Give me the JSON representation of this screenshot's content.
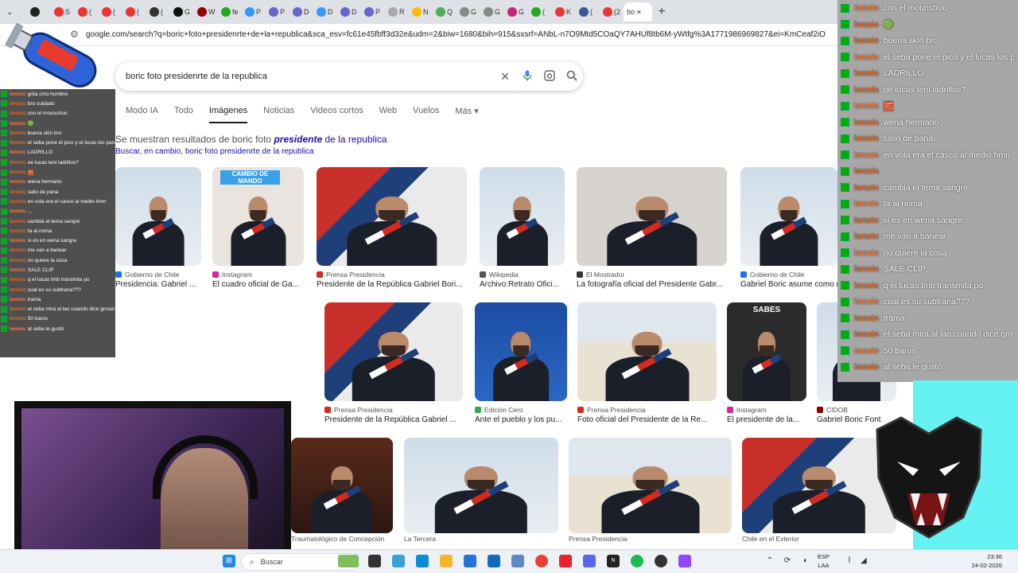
{
  "browser": {
    "tab_labels": [
      "",
      "S",
      "(",
      "(",
      "(",
      "(",
      "G",
      "W",
      "fe",
      "P",
      "P",
      "D",
      "D",
      "D",
      "P",
      "R",
      "N",
      "Q",
      "G",
      "G",
      "G",
      "(",
      "K",
      "(",
      "(2"
    ],
    "active_tab_label": "bo",
    "new_tab": "+",
    "url": "google.com/search?q=boric+foto+presidenrte+de+la+republica&sca_esv=fc61e45fbff3d32e&udm=2&biw=1680&bih=915&sxsrf=ANbL-n7O9Mtd5COaQY7AHUf8tb6M-yWtfg%3A1771986969827&ei=KmCeaf2iON34..."
  },
  "search": {
    "query": "boric foto presidenrte de la republica",
    "clear_icon": "✕",
    "tabs": [
      "Modo IA",
      "Todo",
      "Imágenes",
      "Noticias",
      "Videos cortos",
      "Web",
      "Vuelos",
      "Más ▾"
    ],
    "selected_tab": "Imágenes",
    "showing_prefix": "Se muestran resultados de boric foto",
    "showing_bold": "presidente",
    "showing_suffix": "de la republica",
    "search_instead": "Buscar, en cambio, boric foto presidenrte de la republica"
  },
  "results_row1": [
    {
      "source": "Gobierno de Chile",
      "title": "Presidencia: Gabriel ...",
      "color": "#1a73e8"
    },
    {
      "source": "Instagram",
      "title": "El cuadro oficial de Ga...",
      "color": "#d6249f",
      "badge": "CAMBIO DE MANDO"
    },
    {
      "source": "Prensa Presidencia",
      "title": "Presidente de la República Gabriel Bori...",
      "color": "#d52b1e"
    },
    {
      "source": "Wikipedia",
      "title": "Archivo:Retrato Ofici...",
      "color": "#555555"
    },
    {
      "source": "El Mostrador",
      "title": "La fotografía oficial del Presidente Gabr...",
      "color": "#333333"
    },
    {
      "source": "Gobierno de Chile",
      "title": "Gabriel Boric asume como nuevo Presid...",
      "color": "#1a73e8"
    }
  ],
  "results_row2": [
    {
      "source": "Prensa Presidencia",
      "title": "Presidente de la República Gabriel ...",
      "color": "#d52b1e"
    },
    {
      "source": "Edición Cero",
      "title": "Ante el pueblo y los pu...",
      "color": "#34a853"
    },
    {
      "source": "Prensa Presidencia",
      "title": "Foto oficial del Presidente de la Re...",
      "color": "#d52b1e"
    },
    {
      "source": "Instagram",
      "title": "El presidente de la...",
      "color": "#d6249f",
      "badge": "SABES"
    },
    {
      "source": "CIDOB",
      "title": "Gabriel Boric Font",
      "color": "#8b0000"
    }
  ],
  "results_row3": [
    {
      "source": "Traumatológico de Concepción",
      "title": ""
    },
    {
      "source": "La Tercera",
      "title": ""
    },
    {
      "source": "Prensa Presidencia",
      "title": ""
    },
    {
      "source": "Chile en el Exterior",
      "title": ""
    }
  ],
  "chat_right": [
    {
      "user": "lonxin",
      "text": ": con el mounstruo"
    },
    {
      "user": "lonxin",
      "text": ": 🟢"
    },
    {
      "user": "lonxin",
      "text": ": buena skin bro"
    },
    {
      "user": "lonxin",
      "text": ": el seba pone el pico y el lucas los p"
    },
    {
      "user": "lonxin",
      "text": ": LADRILLO"
    },
    {
      "user": "lonxin",
      "text": ": oe lucas teni ladrillos?"
    },
    {
      "user": "lonxin",
      "text": ": 🧱"
    },
    {
      "user": "lonxin",
      "text": ": wena hermano"
    },
    {
      "user": "lonxin",
      "text": ": salio de pana"
    },
    {
      "user": "lonxin",
      "text": ": en vola era el casco al medio hmn"
    },
    {
      "user": "lonxin",
      "text": ": ..."
    },
    {
      "user": "lonxin",
      "text": ": cambia el tema sangre"
    },
    {
      "user": "lonxin",
      "text": ": ta ai noma"
    },
    {
      "user": "lonxin",
      "text": ": si es en wena sangre"
    },
    {
      "user": "lonxin",
      "text": ": me van a banear"
    },
    {
      "user": "lonxin",
      "text": ": no quiere la cosa"
    },
    {
      "user": "lonxin",
      "text": ": SALE CLIP"
    },
    {
      "user": "lonxin",
      "text": ": q el lucas tmb transmita po"
    },
    {
      "user": "lonxin",
      "text": ": cual es su subtrana???"
    },
    {
      "user": "lonxin",
      "text": ": trama"
    },
    {
      "user": "lonxin",
      "text": ": el seba mira al lao cuando dice gro"
    },
    {
      "user": "lonxin",
      "text": ": 50 baros"
    },
    {
      "user": "lonxin",
      "text": ": al seba le gustó"
    }
  ],
  "chat_left": [
    {
      "user": "lonxin",
      "text": ": grita cmo hombre"
    },
    {
      "user": "lonxin",
      "text": ": bro cuidado"
    },
    {
      "user": "lonxin",
      "text": ": con el mounstruo"
    },
    {
      "user": "lonxin",
      "text": ": 🟢"
    },
    {
      "user": "lonxin",
      "text": ": buena skin bro"
    },
    {
      "user": "lonxin",
      "text": ": el seba pone el pico y el lucas los pana"
    },
    {
      "user": "lonxin",
      "text": ": LADRILLO"
    },
    {
      "user": "lonxin",
      "text": ": oe lucas teni ladrillos?"
    },
    {
      "user": "lonxin",
      "text": ": 🧱"
    },
    {
      "user": "lonxin",
      "text": ": wena hermano"
    },
    {
      "user": "lonxin",
      "text": ": salio de pana"
    },
    {
      "user": "lonxin",
      "text": ": en vola era el casco al medio hmn"
    },
    {
      "user": "lonxin",
      "text": ": ..."
    },
    {
      "user": "lonxin",
      "text": ": cambia el tema sangre"
    },
    {
      "user": "lonxin",
      "text": ": ta ai noma"
    },
    {
      "user": "lonxin",
      "text": ": si es en wena sangre"
    },
    {
      "user": "lonxin",
      "text": ": me van a banear"
    },
    {
      "user": "lonxin",
      "text": ": no quiere la cosa"
    },
    {
      "user": "lonxin",
      "text": ": SALE CLIP"
    },
    {
      "user": "lonxin",
      "text": ": q el lucas tmb transmita po"
    },
    {
      "user": "lonxin",
      "text": ": cual es su subtrana???"
    },
    {
      "user": "lonxin",
      "text": ": trama"
    },
    {
      "user": "lonxin",
      "text": ": el seba mira al lao cuando dice groserias"
    },
    {
      "user": "lonxin",
      "text": ": 50 baros"
    },
    {
      "user": "lonxin",
      "text": ": al seba le gustó"
    }
  ],
  "taskbar": {
    "search_placeholder": "Buscar",
    "lang": "ESP",
    "lang2": "LAA",
    "time": "23:36",
    "date": "24-02-2026"
  },
  "colors": {
    "chat_bg": "#a7a7a7",
    "moderator_badge": "#00ad03",
    "username": "#e96a1e",
    "cyan_panel": "#66f2f2",
    "link": "#1a0dab"
  }
}
